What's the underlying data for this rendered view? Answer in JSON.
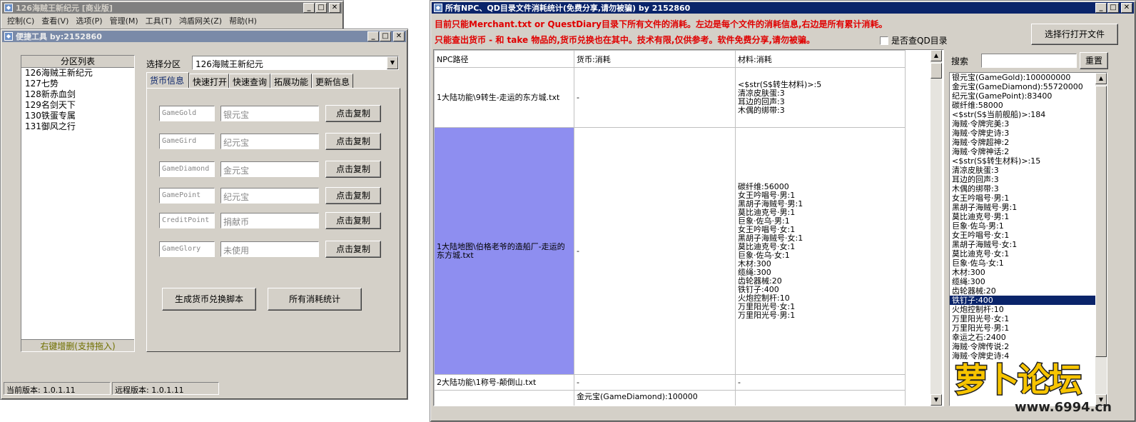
{
  "main_window": {
    "title": "126海贼王新纪元 [商业版]",
    "menu": [
      "控制(C)",
      "查看(V)",
      "选项(P)",
      "管理(M)",
      "工具(T)",
      "鸿盾网关(Z)",
      "帮助(H)"
    ]
  },
  "tool_window": {
    "title": "便捷工具  by:2152860",
    "partition_header": "分区列表",
    "partitions": [
      "126海贼王新纪元",
      "127七势",
      "128新赤血剑",
      "129名剑天下",
      "130铁蛋专属",
      "131御风之行"
    ],
    "partition_hint": "右键增删(支持拖入)",
    "select_label": "选择分区",
    "select_value": "126海贼王新纪元",
    "tabs": [
      "货币信息",
      "快速打开",
      "快速查询",
      "拓展功能",
      "更新信息"
    ],
    "currencies": [
      {
        "code": "GameGold",
        "name": "银元宝",
        "button": "点击复制"
      },
      {
        "code": "GameGird",
        "name": "纪元宝",
        "button": "点击复制"
      },
      {
        "code": "GameDiamond",
        "name": "金元宝",
        "button": "点击复制"
      },
      {
        "code": "GamePoint",
        "name": "纪元宝",
        "button": "点击复制"
      },
      {
        "code": "CreditPoint",
        "name": "捐献币",
        "button": "点击复制"
      },
      {
        "code": "GameGlory",
        "name": "未使用",
        "button": "点击复制"
      }
    ],
    "generate_button": "生成货币兑换脚本",
    "stats_button": "所有消耗统计",
    "status_local": "当前版本: 1.0.1.11",
    "status_remote": "远程版本: 1.0.1.11"
  },
  "stats_window": {
    "title": "所有NPC、QD目录文件消耗统计(免费分享,请勿被骗)   by 2152860",
    "notice1": "目前只能Merchant.txt or QuestDiary目录下所有文件的消耗。左边是每个文件的消耗信息,右边是所有累计消耗。",
    "notice2": "只能查出货币 - 和 take 物品的,货币兑换也在其中。技术有限,仅供参考。软件免费分享,请勿被骗。",
    "checkbox_label": "是否查QD目录",
    "open_button": "选择行打开文件",
    "search_label": "搜索",
    "reset_button": "重置",
    "table_headers": [
      "NPC路径",
      "货币:消耗",
      "材料:消耗"
    ],
    "rows": [
      {
        "path": "1大陆功能\\9转生-走运的东方城.txt",
        "currency": "-",
        "materials": [
          "<$str(S$转生材料)>:5",
          "清凉皮肤蛋:3",
          "耳边的回声:3",
          "木偶的绑带:3"
        ]
      },
      {
        "path": "1大陆地图\\伯格老爷的造船厂-走运的东方城.txt",
        "currency": "-",
        "materials": [
          "碳纤维:56000",
          "女王吟唱号·男:1",
          "黑胡子海贼号·男:1",
          "莫比迪克号·男:1",
          "巨象·佐乌·男:1",
          "女王吟唱号·女:1",
          "黑胡子海贼号·女:1",
          "莫比迪克号·女:1",
          "巨象·佐乌·女:1",
          "木材:300",
          "缆绳:300",
          "齿轮器械:20",
          "铁钉子:400",
          "火炮控制杆:10",
          "万里阳光号·女:1",
          "万里阳光号·男:1"
        ]
      },
      {
        "path": "2大陆功能\\1称号-颠倒山.txt",
        "currency": "-",
        "materials": [
          "-"
        ]
      },
      {
        "path": "",
        "currency": "金元宝(GameDiamond):100000",
        "materials": [
          ""
        ]
      }
    ],
    "totals": [
      "银元宝(GameGold):100000000",
      "金元宝(GameDiamond):55720000",
      "纪元宝(GamePoint):83400",
      "碳纤维:58000",
      "<$str(S$当前舰船)>:184",
      "海贼·令牌完美:3",
      "海贼·令牌史诗:3",
      "海贼·令牌超神:2",
      "海贼·令牌神话:2",
      "<$str(S$转生材料)>:15",
      "清凉皮肤蛋:3",
      "耳边的回声:3",
      "木偶的绑带:3",
      "女王吟唱号·男:1",
      "黑胡子海贼号·男:1",
      "莫比迪克号·男:1",
      "巨象·佐乌·男:1",
      "女王吟唱号·女:1",
      "黑胡子海贼号·女:1",
      "莫比迪克号·女:1",
      "巨象·佐乌·女:1",
      "木材:300",
      "缆绳:300",
      "齿轮器械:20",
      "铁钉子:400",
      "火炮控制杆:10",
      "万里阳光号·女:1",
      "万里阳光号·男:1",
      "幸运之石:2400",
      "海贼·令牌传说:2",
      "海贼·令牌史诗:4"
    ],
    "selected_total_index": 24
  },
  "watermark": {
    "brand": "萝卜论坛",
    "url": "www.6994.cn"
  }
}
